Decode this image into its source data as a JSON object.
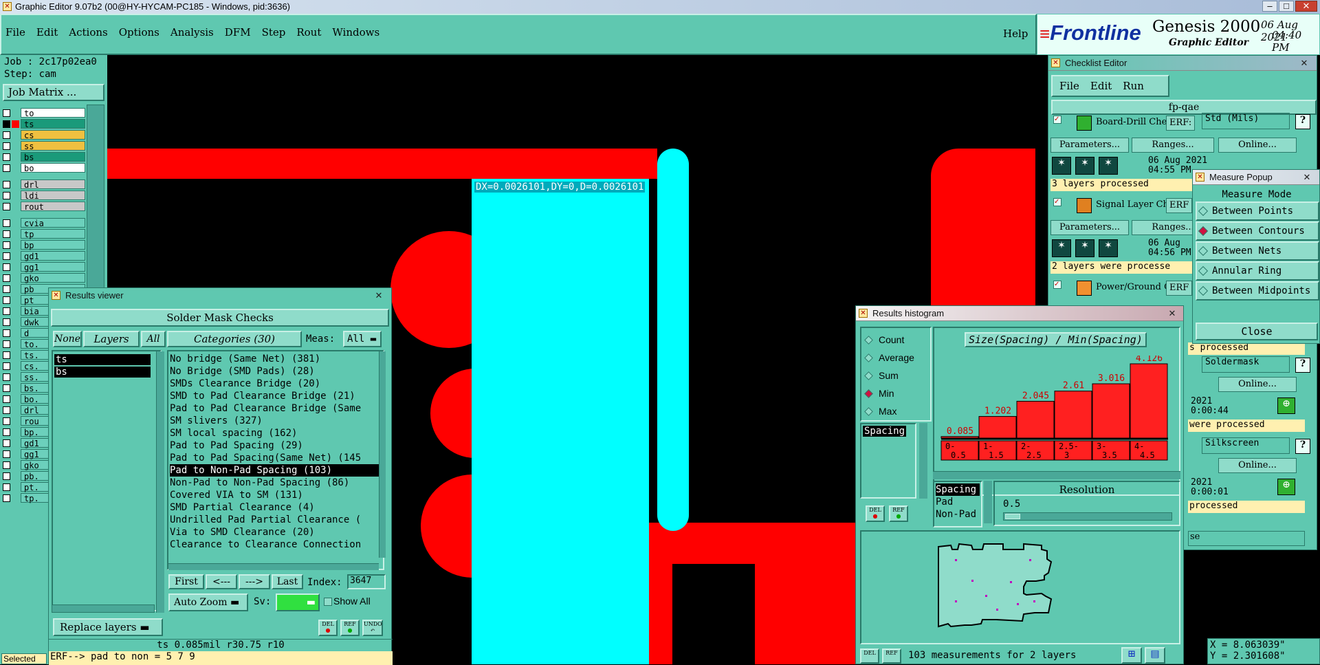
{
  "titlebar": {
    "title": "Graphic Editor 9.07b2 (00@HY-HYCAM-PC185 - Windows, pid:3636)"
  },
  "menu": {
    "items": [
      "File",
      "Edit",
      "Actions",
      "Options",
      "Analysis",
      "DFM",
      "Step",
      "Rout",
      "Windows"
    ],
    "help": "Help"
  },
  "brand": {
    "logo": "Frontline",
    "product": "Genesis 2000",
    "sub": "Graphic Editor",
    "date": "06 Aug 2021",
    "time": "04:40 PM"
  },
  "job": {
    "job": "Job : 2c17p02ea0",
    "step": "Step: cam",
    "matrix_btn": "Job Matrix ..."
  },
  "layers": [
    {
      "name": "to",
      "color": "#ffffff"
    },
    {
      "name": "ts",
      "color": "#1a9a7a"
    },
    {
      "name": "cs",
      "color": "#f0c040"
    },
    {
      "name": "ss",
      "color": "#f0c040"
    },
    {
      "name": "bs",
      "color": "#1a9a7a"
    },
    {
      "name": "bo",
      "color": "#ffffff"
    },
    {
      "name": "drl",
      "color": "#c8c8c8"
    },
    {
      "name": "ldi",
      "color": "#c8c8c8"
    },
    {
      "name": "rout",
      "color": "#c8c8c8"
    },
    {
      "name": "cvia",
      "color": "#6cd0bc"
    },
    {
      "name": "tp",
      "color": "#6cd0bc"
    },
    {
      "name": "bp",
      "color": "#6cd0bc"
    },
    {
      "name": "gd1",
      "color": "#6cd0bc"
    },
    {
      "name": "gg1",
      "color": "#6cd0bc"
    },
    {
      "name": "gko",
      "color": "#6cd0bc"
    },
    {
      "name": "pb",
      "color": "#6cd0bc"
    },
    {
      "name": "pt",
      "color": "#6cd0bc"
    },
    {
      "name": "bia",
      "color": "#6cd0bc"
    },
    {
      "name": "dwk",
      "color": "#6cd0bc"
    },
    {
      "name": "d",
      "color": "#6cd0bc"
    },
    {
      "name": "to.",
      "color": "#6cd0bc"
    },
    {
      "name": "ts.",
      "color": "#6cd0bc"
    },
    {
      "name": "cs.",
      "color": "#6cd0bc"
    },
    {
      "name": "ss.",
      "color": "#6cd0bc"
    },
    {
      "name": "bs.",
      "color": "#6cd0bc"
    },
    {
      "name": "bo.",
      "color": "#6cd0bc"
    },
    {
      "name": "drl",
      "color": "#6cd0bc"
    },
    {
      "name": "rou",
      "color": "#6cd0bc"
    },
    {
      "name": "bp.",
      "color": "#6cd0bc"
    },
    {
      "name": "gd1",
      "color": "#6cd0bc"
    },
    {
      "name": "gg1",
      "color": "#6cd0bc"
    },
    {
      "name": "gko",
      "color": "#6cd0bc"
    },
    {
      "name": "pb.",
      "color": "#6cd0bc"
    },
    {
      "name": "pt.",
      "color": "#6cd0bc"
    },
    {
      "name": "tp.",
      "color": "#6cd0bc"
    }
  ],
  "canvas": {
    "measure_text": "DX=0.0026101,DY=0,D=0.0026101",
    "coords": {
      "x": "X = 8.063039\"",
      "y": "Y = 2.301608\""
    }
  },
  "results_viewer": {
    "title": "Results viewer",
    "header": "Solder Mask Checks",
    "none_btn": "None",
    "layers_btn": "Layers",
    "all_btn": "All",
    "layers": [
      "ts",
      "bs"
    ],
    "categories_btn": "Categories (30)",
    "meas_label": "Meas:",
    "meas_value": "All",
    "categories": [
      "No bridge (Same Net) (381)",
      "No Bridge (SMD Pads) (28)",
      "SMDs Clearance Bridge (20)",
      "SMD to Pad Clearance Bridge (21)",
      "Pad to Pad Clearance Bridge (Same",
      "SM slivers (327)",
      "SM local spacing (162)",
      "Pad to Pad Spacing (29)",
      "Pad to Pad Spacing(Same Net) (145",
      "Pad to Non-Pad Spacing (103)",
      "Non-Pad to Non-Pad Spacing (86)",
      "Covered VIA to SM (131)",
      "SMD Partial Clearance (4)",
      "Undrilled Pad Partial Clearance (",
      "Via to SMD Clearance (20)",
      "Clearance to Clearance Connection"
    ],
    "selected_index": 9,
    "nav": {
      "first": "First",
      "prev": "<---",
      "next": "--->",
      "last": "Last",
      "index_label": "Index:",
      "index_value": "3647"
    },
    "zoom": "Auto Zoom",
    "sv": "Sv:",
    "show_all": "Show All",
    "replace": "Replace layers",
    "status": "ts 0.085mil  r30.75  r10",
    "erf": "ERF--> pad to non = 5 7 9",
    "selected": "Selected"
  },
  "histogram": {
    "title": "Results histogram",
    "modes": [
      "Count",
      "Average",
      "Sum",
      "Min",
      "Max"
    ],
    "selected_mode": "Min",
    "list": [
      "Spacing"
    ],
    "heading": "Size(Spacing) / Min(Spacing)",
    "resolution_label": "Resolution",
    "resolution_value": "0.5",
    "types": [
      "Spacing",
      "Pad",
      "Non-Pad"
    ],
    "summary": "103 measurements for 2 layers"
  },
  "chart_data": {
    "type": "bar",
    "title": "Size(Spacing) / Min(Spacing)",
    "categories": [
      "0-\n0.5",
      "1-\n1.5",
      "2-\n2.5",
      "2.5-\n3",
      "3-\n3.5",
      "4-\n4.5"
    ],
    "values": [
      0.085,
      1.202,
      2.045,
      2.61,
      3.016,
      4.126
    ],
    "xlabel": "",
    "ylabel": ""
  },
  "checklist": {
    "title": "Checklist Editor",
    "menu": [
      "File",
      "Edit",
      "Run"
    ],
    "name": "fp-qae",
    "items": [
      {
        "label": "Board-Drill Che",
        "erf": "ERF:",
        "erf_value": "Std (Mils)",
        "date": "06 Aug 2021",
        "time": "04:55 PM -",
        "status": "3 layers processed"
      },
      {
        "label": "Signal Layer Ch",
        "erf": "ERF",
        "date": "06 Aug",
        "time": "04:56 PM -",
        "status": "2 layers were processe"
      },
      {
        "label": "Power/Ground C",
        "erf": "ERF"
      }
    ],
    "params": "Parameters...",
    "ranges": "Ranges...",
    "online": "Online...",
    "lower": [
      {
        "status": "s processed",
        "erf_value": "Soldermask",
        "year": "2021",
        "dur": "0:00:44",
        "status2": "were processed"
      },
      {
        "erf_value": "Silkscreen",
        "year": "2021",
        "dur": "0:00:01",
        "status2": "processed"
      }
    ],
    "close_partial": "se"
  },
  "measure": {
    "title": "Measure Popup",
    "heading": "Measure Mode",
    "options": [
      "Between Points",
      "Between Contours",
      "Between Nets",
      "Annular Ring",
      "Between Midpoints"
    ],
    "selected": "Between Contours",
    "close": "Close"
  }
}
